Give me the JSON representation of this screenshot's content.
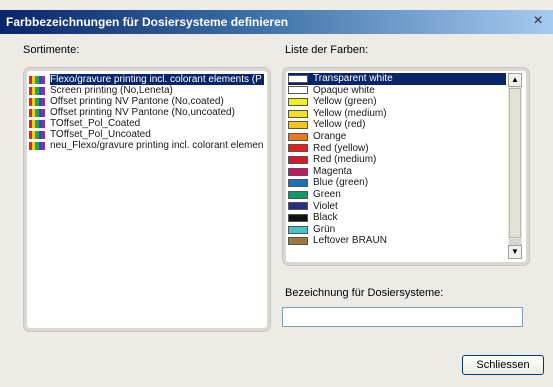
{
  "window": {
    "title": "Farbbezeichnungen für Dosiersysteme definieren",
    "close_label": "×"
  },
  "sortimente": {
    "label": "Sortimente:",
    "items": [
      {
        "label": "Flexo/gravure printing incl. colorant elements (P",
        "selected": true
      },
      {
        "label": "Screen printing (No,Leneta)",
        "selected": false
      },
      {
        "label": "Offset printing NV Pantone (No,coated)",
        "selected": false
      },
      {
        "label": "Offset printing NV Pantone (No,uncoated)",
        "selected": false
      },
      {
        "label": "TOffset_Pol_Coated",
        "selected": false
      },
      {
        "label": "TOffset_Pol_Uncoated",
        "selected": false
      },
      {
        "label": "neu_Flexo/gravure printing incl. colorant elemen",
        "selected": false
      }
    ],
    "icon_colors": [
      "#d62a1f",
      "#f2d21b",
      "#2aa34a",
      "#2452c4",
      "#8a2fb0"
    ]
  },
  "farben": {
    "label": "Liste der Farben:",
    "items": [
      {
        "label": "Transparent white",
        "color": "#ffffff",
        "selected": true
      },
      {
        "label": "Opaque white",
        "color": "#ffffff",
        "selected": false
      },
      {
        "label": "Yellow (green)",
        "color": "#f3f01c",
        "selected": false
      },
      {
        "label": "Yellow (medium)",
        "color": "#f3e01c",
        "selected": false
      },
      {
        "label": "Yellow (red)",
        "color": "#f2c619",
        "selected": false
      },
      {
        "label": "Orange",
        "color": "#ef7a1d",
        "selected": false
      },
      {
        "label": "Red (yellow)",
        "color": "#e2231a",
        "selected": false
      },
      {
        "label": "Red (medium)",
        "color": "#d0182b",
        "selected": false
      },
      {
        "label": "Magenta",
        "color": "#c3185f",
        "selected": false
      },
      {
        "label": "Blue (green)",
        "color": "#1a72b8",
        "selected": false
      },
      {
        "label": "Green",
        "color": "#0f9a6a",
        "selected": false
      },
      {
        "label": "Violet",
        "color": "#2a2f86",
        "selected": false
      },
      {
        "label": "Black",
        "color": "#111111",
        "selected": false
      },
      {
        "label": "Grün",
        "color": "#47c4c2",
        "selected": false
      },
      {
        "label": "Leftover BRAUN",
        "color": "#9a7a3e",
        "selected": false
      }
    ]
  },
  "bezeichnung": {
    "label": "Bezeichnung für Dosiersysteme:",
    "value": ""
  },
  "buttons": {
    "close": "Schliessen"
  }
}
